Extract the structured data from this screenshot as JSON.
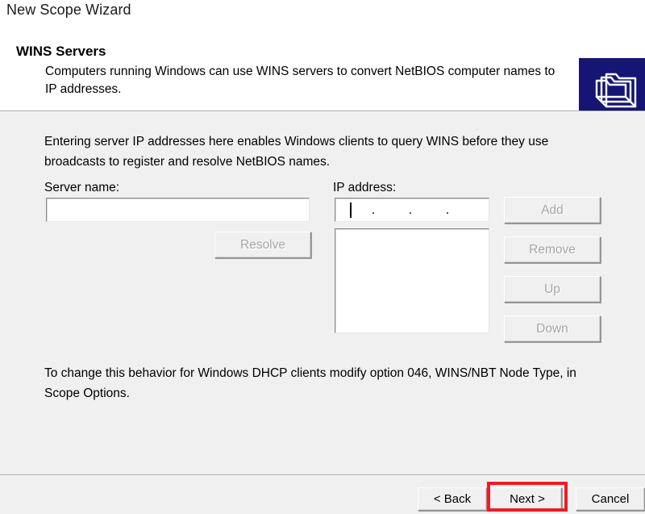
{
  "window": {
    "title": "New Scope Wizard"
  },
  "header": {
    "title": "WINS Servers",
    "description": "Computers running Windows can use WINS servers to convert NetBIOS computer names to IP addresses.",
    "icon": "folder-stack-icon",
    "icon_background": "#151575"
  },
  "body": {
    "intro": "Entering server IP addresses here enables Windows clients to query WINS before they use broadcasts to register and resolve NetBIOS names.",
    "server_name": {
      "label": "Server name:",
      "value": "",
      "placeholder": ""
    },
    "ip_address": {
      "label": "IP address:",
      "value": "",
      "segments": [
        "",
        "",
        "",
        ""
      ],
      "separator": "."
    },
    "ip_list": {
      "items": []
    },
    "buttons": {
      "resolve": "Resolve",
      "add": "Add",
      "remove": "Remove",
      "up": "Up",
      "down": "Down"
    },
    "note": "To change this behavior for Windows DHCP clients modify option 046, WINS/NBT Node Type, in Scope Options."
  },
  "footer": {
    "back": "< Back",
    "next": "Next >",
    "cancel": "Cancel",
    "highlight_color": "#ed1c24",
    "highlighted_button": "next"
  }
}
